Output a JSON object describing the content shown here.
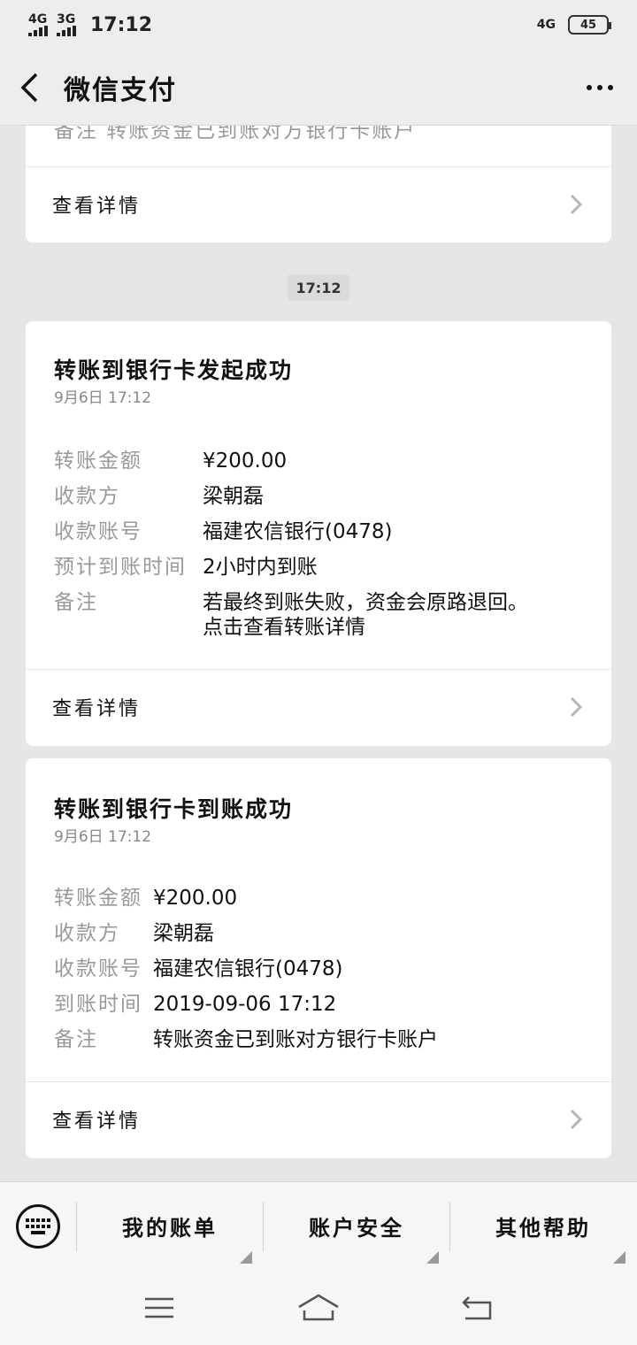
{
  "status_bar": {
    "sim1": "4G",
    "sim2": "3G",
    "time": "17:12",
    "net": "4G",
    "battery": "45"
  },
  "header": {
    "title": "微信支付"
  },
  "top_card": {
    "partial_text": "备注    转账资金已到账对方银行卡账户",
    "detail_label": "查看详情"
  },
  "timestamp": "17:12",
  "card1": {
    "title": "转账到银行卡发起成功",
    "date": "9月6日  17:12",
    "rows": [
      {
        "key": "转账金额",
        "value": "¥200.00"
      },
      {
        "key": "收款方",
        "value": "梁朝磊"
      },
      {
        "key": "收款账号",
        "value": "福建农信银行(0478)"
      },
      {
        "key": "预计到账时间",
        "value": "2小时内到账"
      },
      {
        "key": "备注",
        "value": "若最终到账失败，资金会原路退回。",
        "value2": "点击查看转账详情"
      }
    ],
    "detail_label": "查看详情"
  },
  "card2": {
    "title": "转账到银行卡到账成功",
    "date": "9月6日  17:12",
    "rows": [
      {
        "key": "转账金额",
        "value": "¥200.00"
      },
      {
        "key": "收款方",
        "value": "梁朝磊"
      },
      {
        "key": "收款账号",
        "value": "福建农信银行(0478)"
      },
      {
        "key": "到账时间",
        "value": "2019-09-06 17:12"
      },
      {
        "key": "备注",
        "value": "转账资金已到账对方银行卡账户"
      }
    ],
    "detail_label": "查看详情"
  },
  "bottom_menu": {
    "items": [
      "我的账单",
      "账户安全",
      "其他帮助"
    ]
  }
}
